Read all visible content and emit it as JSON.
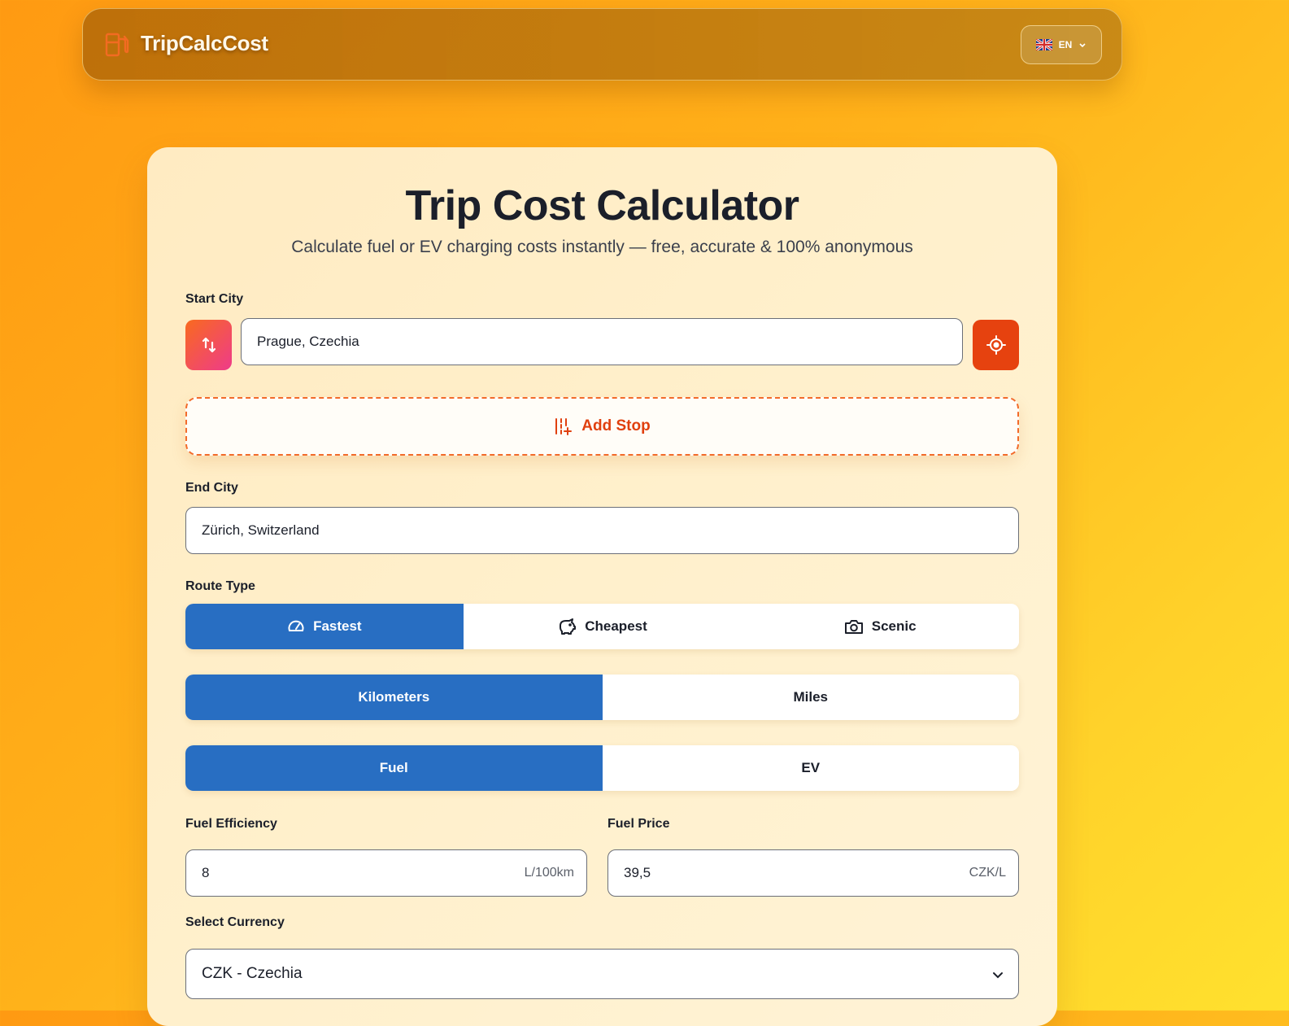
{
  "header": {
    "brand": "TripCalcCost",
    "language": "EN"
  },
  "main": {
    "title": "Trip Cost Calculator",
    "subtitle": "Calculate fuel or EV charging costs instantly — free, accurate & 100% anonymous",
    "start_city": {
      "label": "Start City",
      "value": "Prague, Czechia"
    },
    "add_stop_label": "Add Stop",
    "end_city": {
      "label": "End City",
      "value": "Zürich, Switzerland"
    },
    "route_type": {
      "label": "Route Type",
      "options": [
        "Fastest",
        "Cheapest",
        "Scenic"
      ],
      "selected": "Fastest"
    },
    "distance_unit": {
      "options": [
        "Kilometers",
        "Miles"
      ],
      "selected": "Kilometers"
    },
    "vehicle_type": {
      "options": [
        "Fuel",
        "EV"
      ],
      "selected": "Fuel"
    },
    "fuel_efficiency": {
      "label": "Fuel Efficiency",
      "value": "8",
      "unit": "L/100km"
    },
    "fuel_price": {
      "label": "Fuel Price",
      "value": "39,5",
      "unit": "CZK/L"
    },
    "currency": {
      "label": "Select Currency",
      "value": "CZK - Czechia"
    }
  },
  "colors": {
    "accent_blue": "#286ec2",
    "accent_orange": "#e6420f",
    "background_gradient_start": "#ff9a12",
    "background_gradient_end": "#ffe12e"
  }
}
